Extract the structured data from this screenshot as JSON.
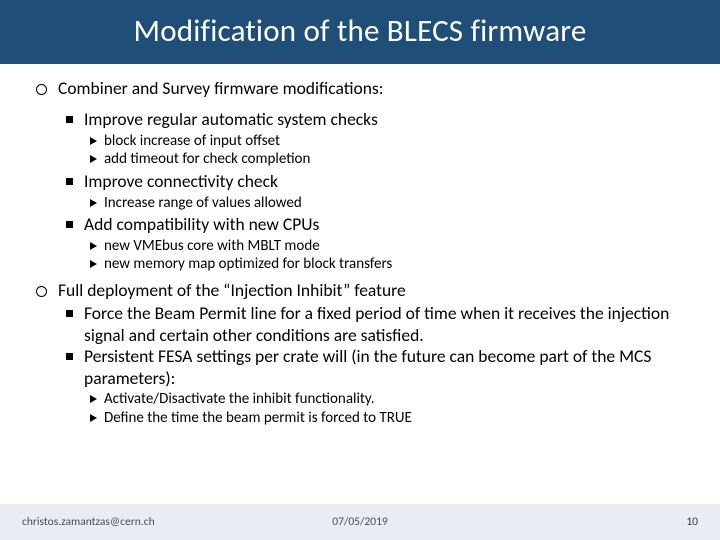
{
  "title": "Modification of the BLECS firmware",
  "bullets": {
    "b1": "Combiner and Survey firmware modifications:",
    "b1_1": "Improve regular automatic system checks",
    "b1_1_1": "block increase of input offset",
    "b1_1_2": "add timeout for check completion",
    "b1_2": "Improve connectivity check",
    "b1_2_1": "Increase range of values allowed",
    "b1_3": "Add compatibility with new CPUs",
    "b1_3_1": "new VMEbus core with MBLT mode",
    "b1_3_2": "new memory map optimized for block transfers",
    "b2": "Full deployment of the “Injection Inhibit” feature",
    "b2_1": "Force the Beam Permit line for a fixed period of time when it receives the injection signal and certain other conditions are satisfied.",
    "b2_2": "Persistent FESA settings per crate will (in the future can become part of the MCS parameters):",
    "b2_2_1": "Activate/Disactivate the inhibit functionality.",
    "b2_2_2": "Define the time the beam permit is forced to TRUE"
  },
  "footer": {
    "author": "christos.zamantzas@cern.ch",
    "date": "07/05/2019",
    "page": "10"
  }
}
